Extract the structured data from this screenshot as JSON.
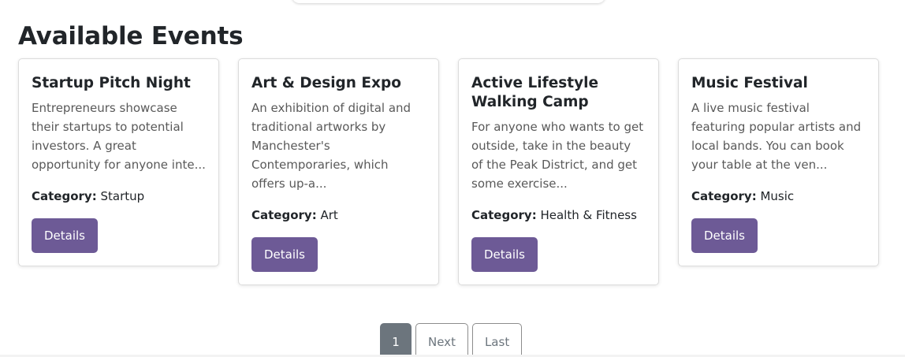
{
  "section": {
    "title": "Available Events"
  },
  "events": [
    {
      "title": "Startup Pitch Night",
      "description": "Entrepreneurs showcase their startups to potential investors. A great opportunity for anyone inte...",
      "category_label": "Category:",
      "category": "Startup",
      "button": "Details"
    },
    {
      "title": "Art & Design Expo",
      "description": "An exhibition of digital and traditional artworks by Manchester's Contemporaries, which offers up-a...",
      "category_label": "Category:",
      "category": "Art",
      "button": "Details"
    },
    {
      "title": "Active Lifestyle Walking Camp",
      "description": "For anyone who wants to get outside, take in the beauty of the Peak District, and get some exercise...",
      "category_label": "Category:",
      "category": "Health & Fitness",
      "button": "Details"
    },
    {
      "title": "Music Festival",
      "description": "A live music festival featuring popular artists and local bands. You can book your table at the ven...",
      "category_label": "Category:",
      "category": "Music",
      "button": "Details"
    }
  ],
  "pagination": {
    "current": "1",
    "next": "Next",
    "last": "Last"
  },
  "colors": {
    "button": "#6d5a96",
    "active_page": "#6c757d"
  }
}
